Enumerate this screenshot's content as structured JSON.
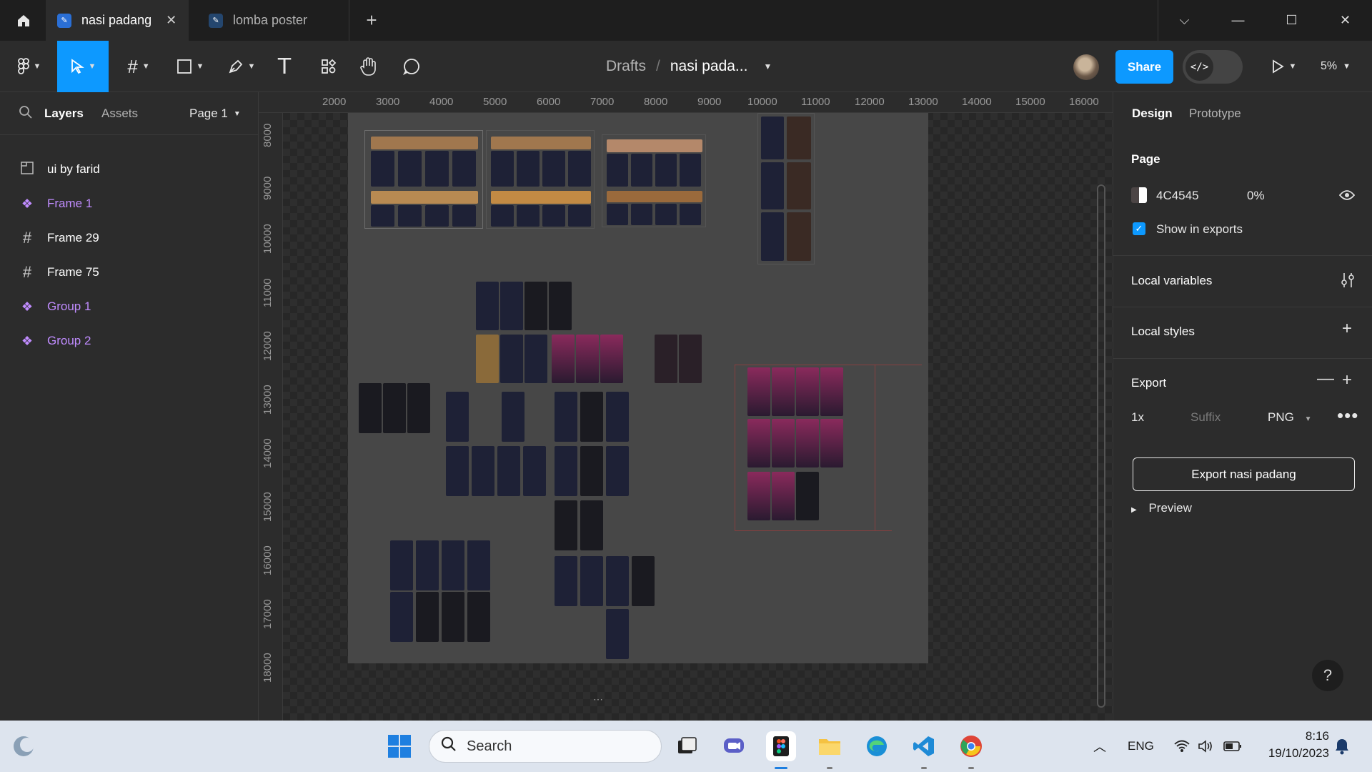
{
  "tabs": [
    {
      "label": "nasi padang",
      "active": true
    },
    {
      "label": "lomba poster",
      "active": false
    }
  ],
  "tab_close": "✕",
  "new_tab": "+",
  "window_controls": {
    "dropdown": "⌵",
    "minimize": "—",
    "maximize": "☐",
    "close": "✕"
  },
  "breadcrumb": {
    "root": "Drafts",
    "separator": "/",
    "file": "nasi pada..."
  },
  "share_label": "Share",
  "dev_mode_icon": "</>",
  "zoom": "5%",
  "left_panel": {
    "tabs": {
      "layers": "Layers",
      "assets": "Assets",
      "page": "Page 1"
    },
    "layers": [
      {
        "name": "ui by farid",
        "type": "section",
        "icon": "section-icon"
      },
      {
        "name": "Frame 1",
        "type": "component",
        "icon": "component-icon"
      },
      {
        "name": "Frame 29",
        "type": "frame",
        "icon": "frame-icon"
      },
      {
        "name": "Frame 75",
        "type": "frame",
        "icon": "frame-icon"
      },
      {
        "name": "Group 1",
        "type": "component",
        "icon": "component-icon"
      },
      {
        "name": "Group 2",
        "type": "component",
        "icon": "component-icon"
      }
    ]
  },
  "ruler_top": [
    "2000",
    "3000",
    "4000",
    "5000",
    "6000",
    "7000",
    "8000",
    "9000",
    "10000",
    "11000",
    "12000",
    "13000",
    "14000",
    "15000",
    "16000"
  ],
  "ruler_left": [
    "8000",
    "9000",
    "10000",
    "11000",
    "12000",
    "13000",
    "14000",
    "15000",
    "16000",
    "17000",
    "18000"
  ],
  "right_panel": {
    "tabs": {
      "design": "Design",
      "prototype": "Prototype"
    },
    "page": {
      "heading": "Page",
      "color_hex": "4C4545",
      "opacity": "0%",
      "show_in_exports": "Show in exports"
    },
    "local_variables": "Local variables",
    "local_styles": "Local styles",
    "export": {
      "heading": "Export",
      "scale": "1x",
      "suffix_placeholder": "Suffix",
      "format": "PNG",
      "button": "Export nasi padang",
      "preview": "Preview"
    }
  },
  "help": "?",
  "taskbar": {
    "search_placeholder": "Search",
    "lang": "ENG",
    "time": "8:16",
    "date": "19/10/2023"
  },
  "colors": {
    "accent": "#0d99ff",
    "component": "#c08cff",
    "page_bg": "#4C4545"
  }
}
